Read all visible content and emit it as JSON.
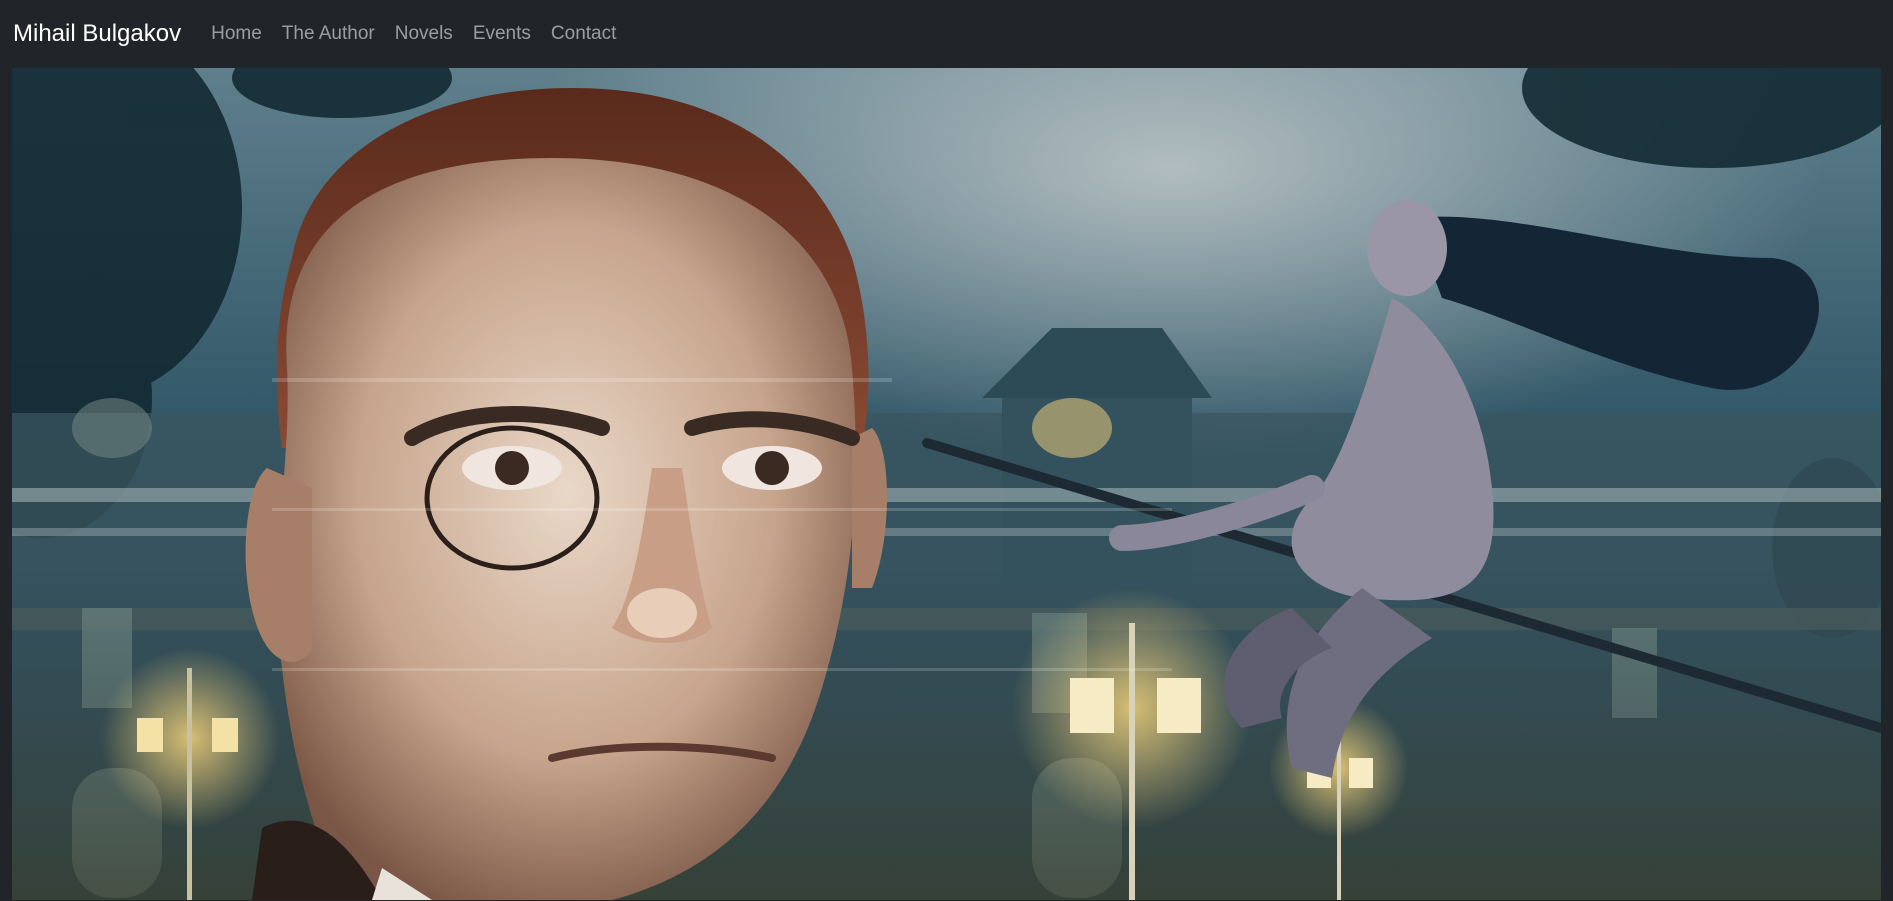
{
  "navbar": {
    "brand": "Mihail Bulgakov",
    "links": [
      {
        "label": "Home"
      },
      {
        "label": "The Author"
      },
      {
        "label": "Novels"
      },
      {
        "label": "Events"
      },
      {
        "label": "Contact"
      }
    ]
  },
  "hero": {
    "image_description_icon": "portrait-with-flying-witch-illustration"
  },
  "colors": {
    "navbar_bg": "#212529",
    "brand_text": "#ffffff",
    "nav_link_text": "rgba(255,255,255,0.55)"
  }
}
